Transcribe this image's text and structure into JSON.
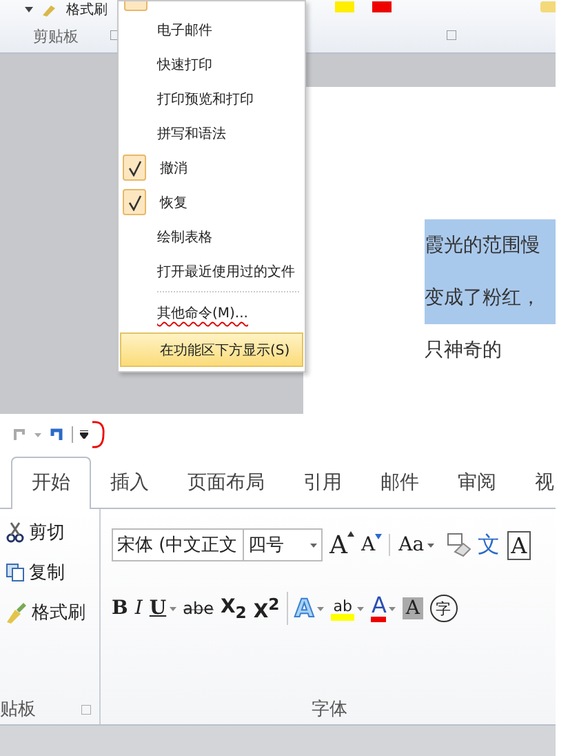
{
  "top_shot": {
    "ribbon": {
      "format_painter": "格式刷",
      "group_label": "剪贴板"
    },
    "menu": {
      "items": [
        {
          "label": "电子邮件",
          "kind": "toggle",
          "checked": false,
          "selected": false,
          "annotated": false
        },
        {
          "label": "快速打印",
          "kind": "toggle",
          "checked": false,
          "selected": false,
          "annotated": false
        },
        {
          "label": "打印预览和打印",
          "kind": "toggle",
          "checked": false,
          "selected": false,
          "annotated": false
        },
        {
          "label": "拼写和语法",
          "kind": "toggle",
          "checked": false,
          "selected": false,
          "annotated": false
        },
        {
          "label": "撤消",
          "kind": "toggle",
          "checked": true,
          "selected": false,
          "annotated": false
        },
        {
          "label": "恢复",
          "kind": "toggle",
          "checked": true,
          "selected": false,
          "annotated": false
        },
        {
          "label": "绘制表格",
          "kind": "toggle",
          "checked": false,
          "selected": false,
          "annotated": false
        },
        {
          "label": "打开最近使用过的文件",
          "kind": "toggle",
          "checked": false,
          "selected": false,
          "annotated": false
        },
        {
          "label": "其他命令(M)...",
          "kind": "command",
          "checked": false,
          "selected": false,
          "annotated": true
        },
        {
          "label": "在功能区下方显示(S)",
          "kind": "command",
          "checked": false,
          "selected": true,
          "annotated": false
        }
      ]
    },
    "document": {
      "lines": [
        {
          "text": "霞光的范围慢",
          "selected": true
        },
        {
          "text": "变成了粉红，",
          "selected": true
        },
        {
          "text": "只神奇的",
          "selected": false
        }
      ]
    }
  },
  "bottom_shot": {
    "qat_dropdown": {
      "annotated": true
    },
    "tabs": [
      {
        "label": "开始",
        "selected": true
      },
      {
        "label": "插入",
        "selected": false
      },
      {
        "label": "页面布局",
        "selected": false
      },
      {
        "label": "引用",
        "selected": false
      },
      {
        "label": "邮件",
        "selected": false
      },
      {
        "label": "审阅",
        "selected": false
      },
      {
        "label": "视",
        "selected": false
      }
    ],
    "clipboard": {
      "buttons": [
        {
          "kind": "cut",
          "label": "剪切"
        },
        {
          "kind": "copy",
          "label": "复制"
        },
        {
          "kind": "paint",
          "label": "格式刷"
        }
      ],
      "group_label": "贴板"
    },
    "font": {
      "font_name": "宋体 (中文正文",
      "font_size": "四号",
      "row1": [
        {
          "kind": "grow",
          "label": "A"
        },
        {
          "kind": "shrink",
          "label": "A"
        },
        {
          "kind": "case",
          "label": "Aa"
        },
        {
          "kind": "clear"
        },
        {
          "kind": "phonetic",
          "label": "文"
        },
        {
          "kind": "boxed",
          "label": "A"
        }
      ],
      "row2": [
        {
          "kind": "bold",
          "label": "B"
        },
        {
          "kind": "italic",
          "label": "I"
        },
        {
          "kind": "underline",
          "label": "U"
        },
        {
          "kind": "strike",
          "label": "abe"
        },
        {
          "kind": "sub",
          "label": "X$_{2}$"
        },
        {
          "kind": "sup",
          "label": "X$^{2}$"
        },
        {
          "kind": "effect",
          "label": "A"
        },
        {
          "kind": "highlight",
          "label": "ab"
        },
        {
          "kind": "color",
          "label": "A"
        },
        {
          "kind": "shade",
          "label": "A"
        },
        {
          "kind": "enclose",
          "label": "字"
        }
      ],
      "group_label": "字体"
    }
  }
}
